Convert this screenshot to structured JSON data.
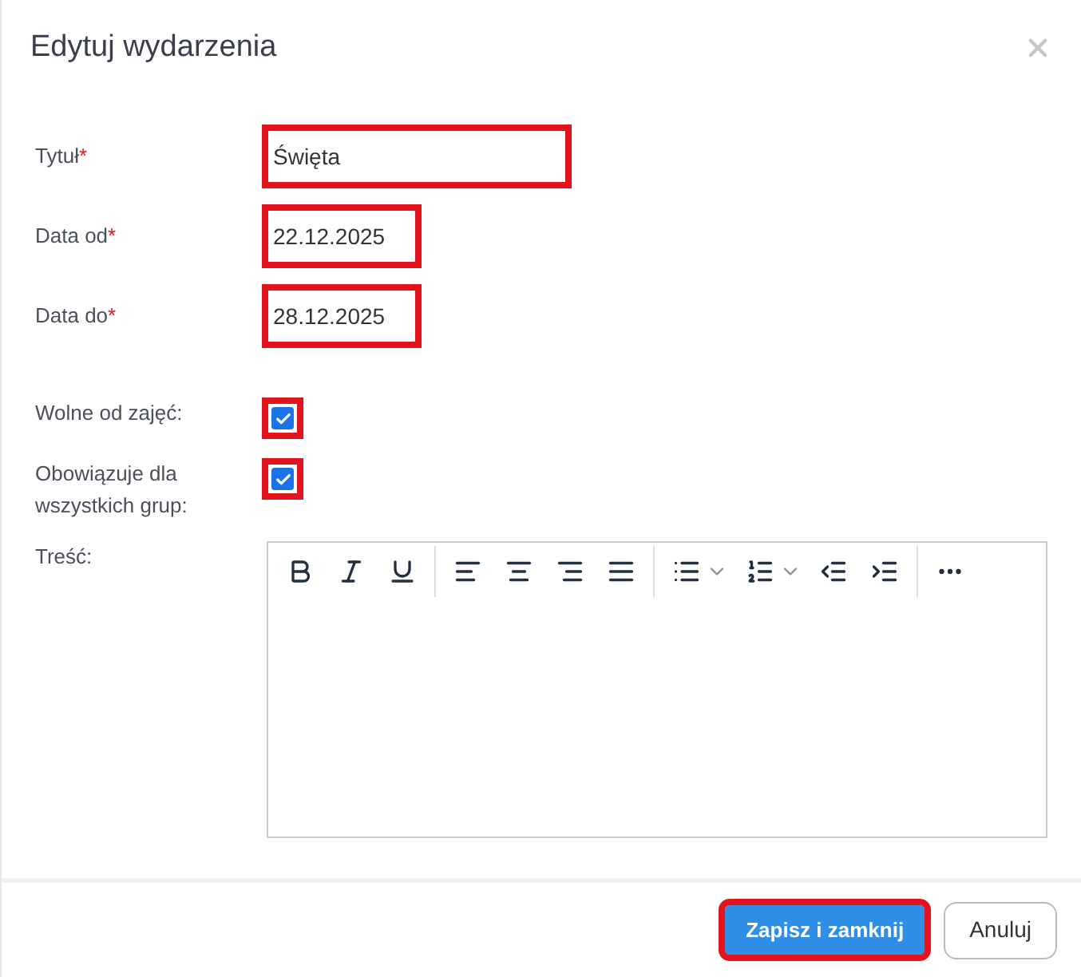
{
  "dialog": {
    "title": "Edytuj wydarzenia"
  },
  "fields": [
    {
      "label": "Tytuł",
      "required_mark": "*",
      "value": "Święta",
      "kind": "text",
      "highlighted": true
    },
    {
      "label": "Data od",
      "required_mark": "*",
      "value": "22.12.2025",
      "kind": "date",
      "highlighted": true
    },
    {
      "label": "Data do",
      "required_mark": "*",
      "value": "28.12.2025",
      "kind": "date",
      "highlighted": true
    }
  ],
  "checkboxes": [
    {
      "label": "Wolne od zajęć:",
      "checked": true,
      "highlighted": true
    },
    {
      "label": "Obowiązuje dla wszystkich grup:",
      "checked": true,
      "highlighted": true
    }
  ],
  "editor": {
    "label": "Treść:"
  },
  "buttons": [
    {
      "label": "Zapisz i zamknij",
      "kind": "primary",
      "highlighted": true
    },
    {
      "label": "Anuluj",
      "kind": "secondary",
      "highlighted": false
    }
  ]
}
